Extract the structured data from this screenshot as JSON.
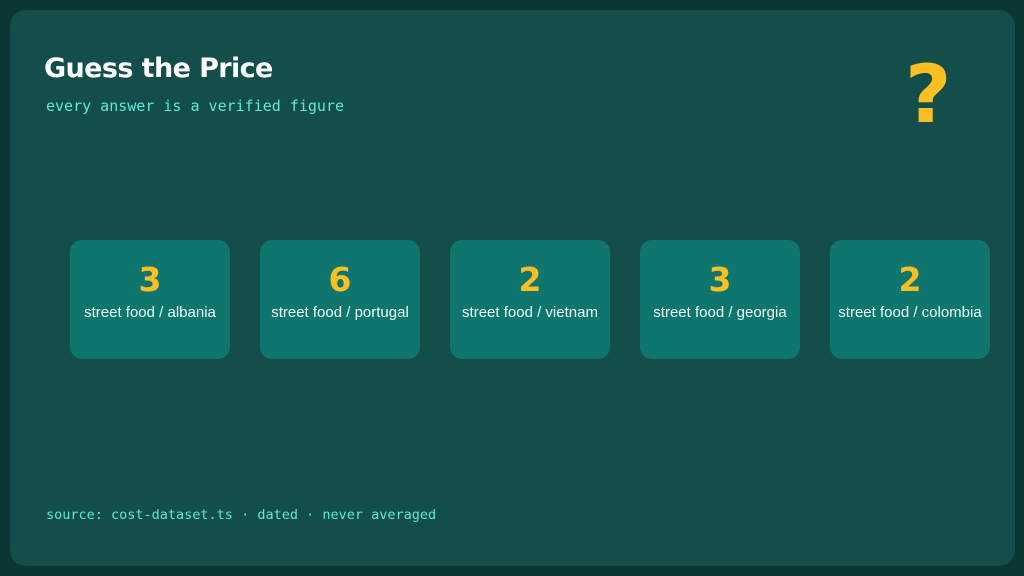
{
  "header": {
    "title": "Guess the Price",
    "subtitle": "every answer is a verified figure",
    "mark": "?"
  },
  "cards": [
    {
      "value": "3",
      "label": "street food / albania"
    },
    {
      "value": "6",
      "label": "street food / portugal"
    },
    {
      "value": "2",
      "label": "street food / vietnam"
    },
    {
      "value": "3",
      "label": "street food / georgia"
    },
    {
      "value": "2",
      "label": "street food / colombia"
    }
  ],
  "footer": {
    "text": "source: cost-dataset.ts · dated · never averaged"
  },
  "colors": {
    "background": "#134e4a",
    "card": "#0f766e",
    "accent": "#fbbf24",
    "mono_text": "#5eead4"
  }
}
